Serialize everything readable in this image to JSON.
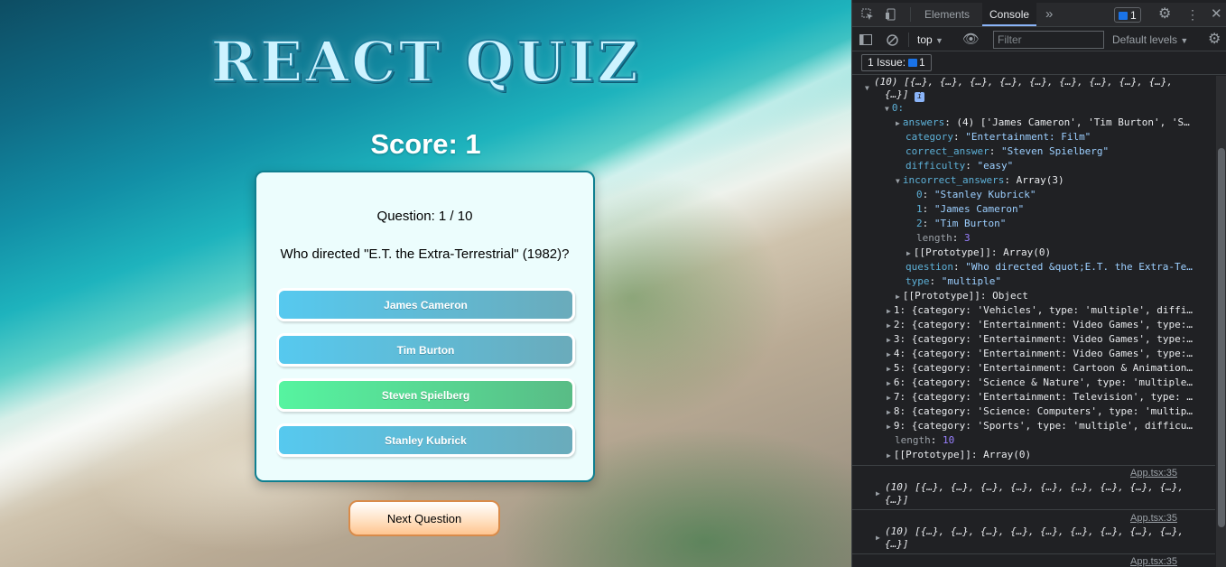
{
  "app": {
    "title": "REACT QUIZ",
    "score": "Score: 1",
    "question_number": "Question: 1 / 10",
    "question": "Who directed \"E.T. the Extra-Terrestrial\" (1982)?",
    "answers": [
      "James Cameron",
      "Tim Burton",
      "Steven Spielberg",
      "Stanley Kubrick"
    ],
    "correct_answer": "Steven Spielberg",
    "next_button": "Next Question"
  },
  "devtools": {
    "tabs": [
      "Elements",
      "Console"
    ],
    "active_tab": "Console",
    "more_tabs_icon": "»",
    "issues_badge_count": "1",
    "context_select": "top",
    "filter_placeholder": "Filter",
    "levels_select": "Default levels",
    "issues_button": "1 Issue:",
    "issues_count": "1",
    "console": {
      "l01": "(10) [{…}, {…}, {…}, {…}, {…}, {…}, {…}, {…}, {…},",
      "l02": "{…}]",
      "l03": "0:",
      "l04_key": "answers",
      "l04_val": ": (4) ['James Cameron', 'Tim Burton', 'S…",
      "l05_key": "category",
      "l05_val": "\"Entertainment: Film\"",
      "l06_key": "correct_answer",
      "l06_val": "\"Steven Spielberg\"",
      "l07_key": "difficulty",
      "l07_val": "\"easy\"",
      "l08_key": "incorrect_answers",
      "l08_val": ": Array(3)",
      "l09_key": "0",
      "l09_val": "\"Stanley Kubrick\"",
      "l10_key": "1",
      "l10_val": "\"James Cameron\"",
      "l11_key": "2",
      "l11_val": "\"Tim Burton\"",
      "l12_key": "length",
      "l12_val": "3",
      "l13": "[[Prototype]]: Array(0)",
      "l14_key": "question",
      "l14_val": "\"Who directed &quot;E.T. the Extra-Te…",
      "l15_key": "type",
      "l15_val": "\"multiple\"",
      "l16": "[[Prototype]]: Object",
      "items": [
        "1: {category: 'Vehicles', type: 'multiple', diffi…",
        "2: {category: 'Entertainment: Video Games', type:…",
        "3: {category: 'Entertainment: Video Games', type:…",
        "4: {category: 'Entertainment: Video Games', type:…",
        "5: {category: 'Entertainment: Cartoon & Animation…",
        "6: {category: 'Science & Nature', type: 'multiple…",
        "7: {category: 'Entertainment: Television', type: …",
        "8: {category: 'Science: Computers', type: 'multip…",
        "9: {category: 'Sports', type: 'multiple', difficu…"
      ],
      "len_key": "length",
      "len_val": "10",
      "proto_array": "[[Prototype]]: Array(0)",
      "source_link": "App.tsx:35",
      "collapsed_line1": "(10) [{…}, {…}, {…}, {…}, {…}, {…}, {…}, {…}, {…},",
      "collapsed_line2": "{…}]"
    }
  },
  "colors": {
    "card_border": "#0f7f90",
    "answer_gradient": [
      "#56c9ef",
      "#6aabbb"
    ],
    "correct_gradient": [
      "#56f4a0",
      "#59bc86"
    ],
    "next_border": "#d98b4a"
  }
}
